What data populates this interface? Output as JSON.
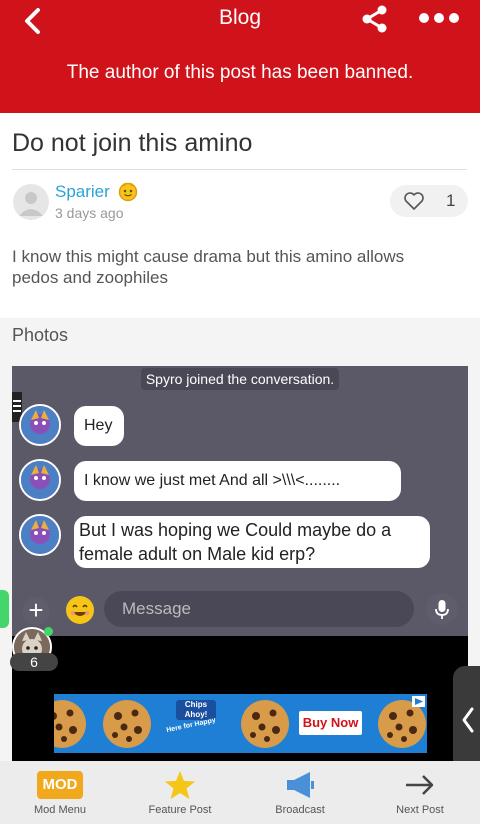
{
  "header": {
    "title": "Blog",
    "banned_notice": "The author of this post has been banned."
  },
  "post": {
    "title": "Do not join this amino",
    "author": "Sparier",
    "time": "3 days ago",
    "like_count": "1",
    "body": "I know this might cause drama but this amino allows pedos and zoophiles"
  },
  "photos": {
    "label": "Photos",
    "chat": {
      "system_message": "Spyro joined the conversation.",
      "messages": [
        {
          "text": "Hey"
        },
        {
          "text": "I know we just met And all >\\\\\\<........"
        },
        {
          "text": "But I was hoping we Could maybe do a female adult on Male kid erp?"
        }
      ],
      "input_placeholder": "Message"
    },
    "ad": {
      "logo": "Chips Ahoy!",
      "tagline": "Here for Happy",
      "cta": "Buy Now"
    }
  },
  "online": {
    "count": "6"
  },
  "bottom_nav": {
    "items": [
      {
        "badge": "MOD",
        "label": "Mod Menu",
        "icon": "mod-badge-icon"
      },
      {
        "label": "Feature Post",
        "icon": "star-icon"
      },
      {
        "label": "Broadcast",
        "icon": "megaphone-icon"
      },
      {
        "label": "Next Post",
        "icon": "arrow-right-icon"
      }
    ]
  },
  "colors": {
    "header_red": "#d0121b",
    "author_blue": "#2aa3d7",
    "mod_orange": "#f2a81d",
    "star_yellow": "#f5c518",
    "broadcast_blue": "#4a90d9",
    "online_green": "#42d66b"
  }
}
